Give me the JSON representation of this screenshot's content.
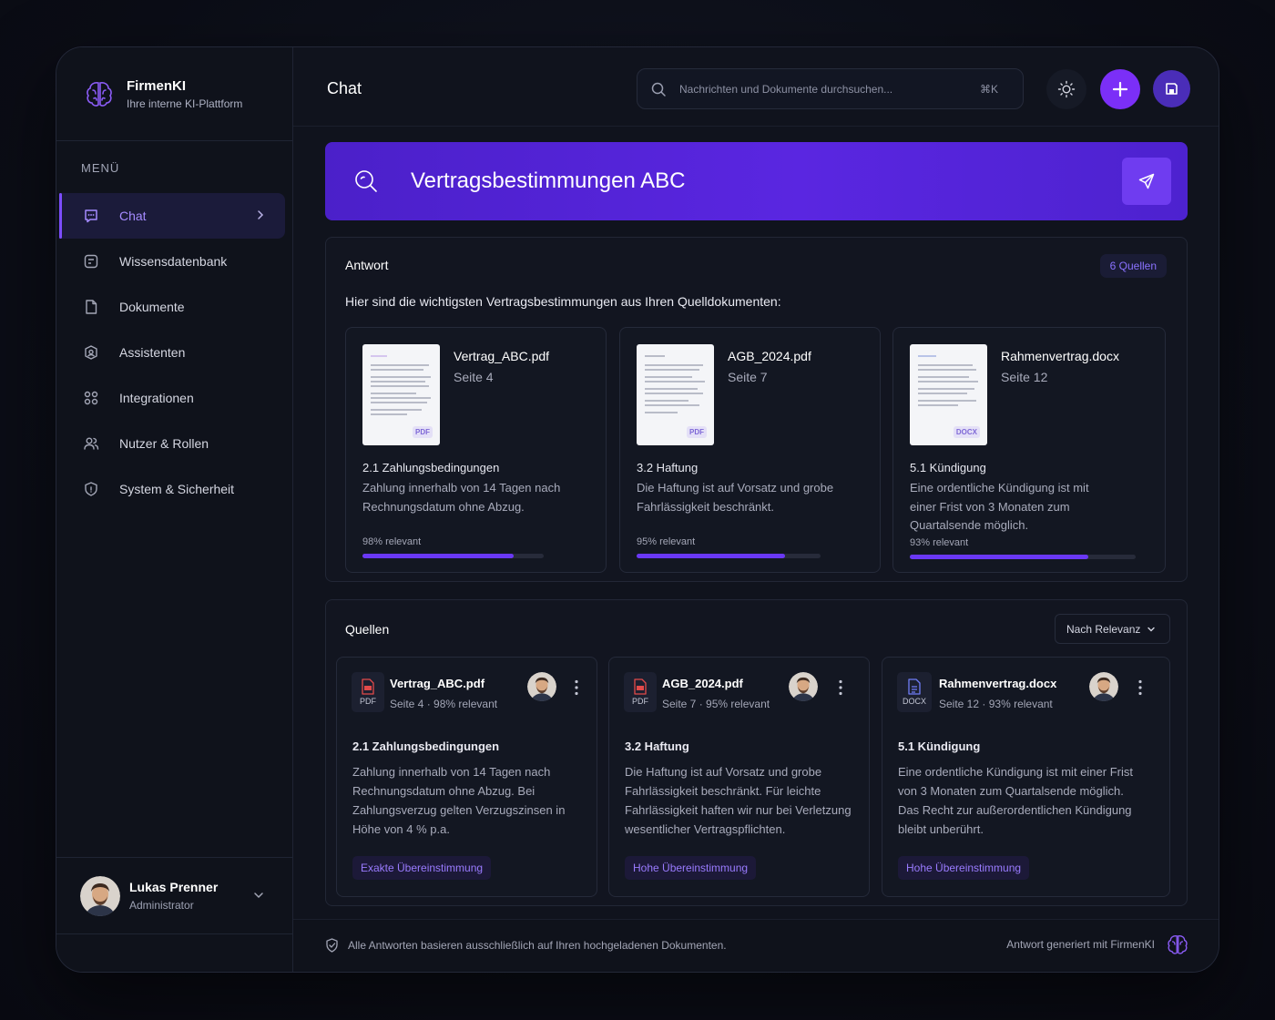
{
  "brand": {
    "name": "FirmenKI",
    "subtitle": "Ihre interne KI-Plattform"
  },
  "sidebar": {
    "menu_label": "MENÜ",
    "items": [
      {
        "label": "Chat",
        "icon": "chat-icon",
        "active": true
      },
      {
        "label": "Wissensdatenbank",
        "icon": "database-icon"
      },
      {
        "label": "Dokumente",
        "icon": "document-icon"
      },
      {
        "label": "Assistenten",
        "icon": "assistant-icon"
      },
      {
        "label": "Integrationen",
        "icon": "integrations-icon"
      },
      {
        "label": "Nutzer & Rollen",
        "icon": "users-icon"
      },
      {
        "label": "System & Sicherheit",
        "icon": "shield-icon"
      }
    ]
  },
  "user": {
    "name": "Lukas Prenner",
    "role": "Administrator"
  },
  "header": {
    "title": "Chat",
    "search_placeholder": "Nachrichten und Dokumente durchsuchen...",
    "search_shortcut": "⌘K"
  },
  "query": {
    "text": "Vertragsbestimmungen ABC"
  },
  "answer": {
    "title": "Antwort",
    "sources_badge": "6 Quellen",
    "intro": "Hier sind die wichtigsten Vertragsbestimmungen aus Ihren Quelldokumenten:",
    "documents": [
      {
        "name": "Vertrag_ABC.pdf",
        "page": "Seite 4",
        "section": "2.1 Zahlungsbedingungen",
        "text": "Zahlung innerhalb von 14 Tagen nach Rechnungsdatum ohne Abzug.",
        "relevance_label": "98% relevant",
        "relevance": 0.98,
        "type": "PDF"
      },
      {
        "name": "AGB_2024.pdf",
        "page": "Seite 7",
        "section": "3.2 Haftung",
        "text": "Die Haftung ist auf Vorsatz und grobe Fahrlässigkeit beschränkt.",
        "relevance_label": "95% relevant",
        "relevance": 0.95,
        "type": "PDF"
      },
      {
        "name": "Rahmenvertrag.docx",
        "page": "Seite 12",
        "section": "5.1 Kündigung",
        "text": "Eine ordentliche Kündigung ist mit einer Frist von 3 Monaten zum Quartalsende möglich.",
        "relevance_label": "93% relevant",
        "relevance": 0.93,
        "type": "DOCX"
      }
    ]
  },
  "sources": {
    "title": "Quellen",
    "sort_label": "Nach Relevanz",
    "items": [
      {
        "name": "Vertrag_ABC.pdf",
        "type": "PDF",
        "page": "Seite 4",
        "relevance": "98% relevant",
        "section": "2.1 Zahlungsbedingungen",
        "text": "Zahlung innerhalb von 14 Tagen nach Rechnungsdatum ohne Abzug. Bei Zahlungsverzug gelten Verzugszinsen in Höhe von 4 % p.a.",
        "match": "Exakte Übereinstimmung"
      },
      {
        "name": "AGB_2024.pdf",
        "type": "PDF",
        "page": "Seite 7",
        "relevance": "95% relevant",
        "section": "3.2 Haftung",
        "text": "Die Haftung ist auf Vorsatz und grobe Fahrlässigkeit beschränkt. Für leichte Fahrlässigkeit haften wir nur bei Verletzung wesentlicher Vertragspflichten.",
        "match": "Hohe Übereinstimmung"
      },
      {
        "name": "Rahmenvertrag.docx",
        "type": "DOCX",
        "page": "Seite 12",
        "relevance": "93% relevant",
        "section": "5.1 Kündigung",
        "text": "Eine ordentliche Kündigung ist mit einer Frist von 3 Monaten zum Quartalsende möglich. Das Recht zur außerordentlichen Kündigung bleibt unberührt.",
        "match": "Hohe Übereinstimmung"
      }
    ]
  },
  "footer": {
    "disclaimer": "Alle Antworten basieren ausschließlich auf Ihren hochgeladenen Dokumenten.",
    "generated_by": "Antwort generiert mit FirmenKI"
  },
  "colors": {
    "accent": "#7b2ff7",
    "accent_light": "#a58bff",
    "background": "#10131d"
  }
}
